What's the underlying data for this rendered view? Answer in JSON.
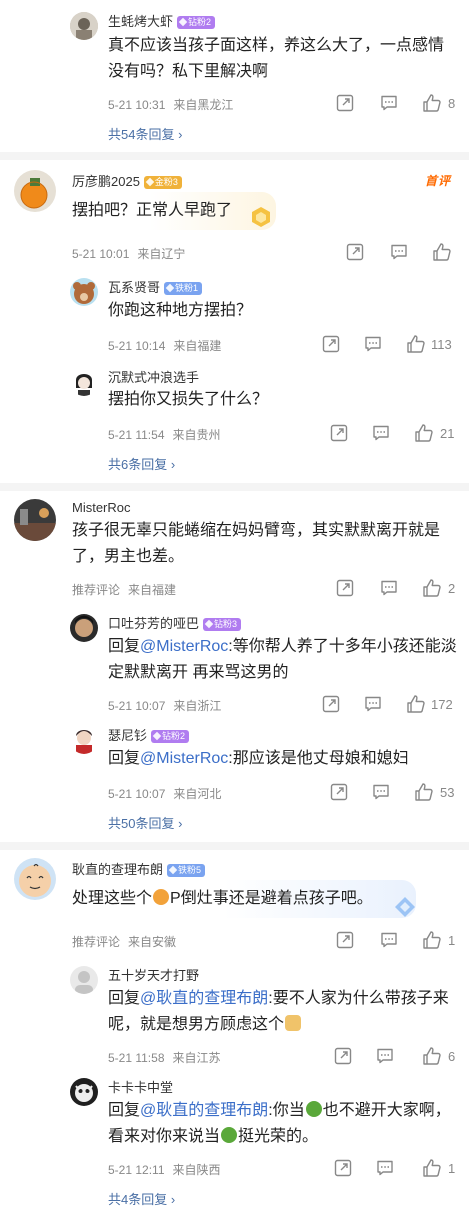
{
  "icons": {
    "share": "share-icon",
    "comment": "comment-icon",
    "like": "thumbs-up-icon",
    "more": "chevron-right-icon"
  },
  "colors": {
    "link": "#3b6ec8",
    "more_link": "#4a6fa5",
    "hot_badge": "#ff6a00",
    "badge_purple": "#b07cf0",
    "badge_blue": "#7aa3f0",
    "badge_gold": "#f0b23a"
  },
  "top_reply": {
    "user": "生蚝烤大虾",
    "badge": "钻粉2",
    "text": "真不应该当孩子面这样，养这么大了，一点感情没有吗？私下里解决啊",
    "time": "5-21 10:31",
    "location": "来自黑龙江",
    "likes": "8",
    "more": "共54条回复"
  },
  "comments": [
    {
      "user": "厉彦鹏2025",
      "badge": "金粉3",
      "hot_label": "首评",
      "text": "摆拍吧？正常人早跑了",
      "time": "5-21 10:01",
      "location": "来自辽宁",
      "likes": "",
      "replies": [
        {
          "user": "瓦系贤哥",
          "badge": "铁粉1",
          "text": "你跑这种地方摆拍？",
          "time": "5-21 10:14",
          "location": "来自福建",
          "likes": "113"
        },
        {
          "user": "沉默式冲浪选手",
          "badge": "",
          "text": "摆拍你又损失了什么？",
          "time": "5-21 11:54",
          "location": "来自贵州",
          "likes": "21"
        }
      ],
      "more": "共6条回复"
    },
    {
      "user": "MisterRoc",
      "badge": "",
      "text": "孩子很无辜只能蜷缩在妈妈臂弯，其实默默离开就是了，男主也差。",
      "time": "推荐评论",
      "location": "来自福建",
      "likes": "2",
      "replies": [
        {
          "user": "口吐芬芳的哑巴",
          "badge": "钻粉3",
          "reply_prefix": "回复",
          "mention": "@MisterRoc",
          "text": ":等你帮人养了十多年小孩还能淡定默默离开 再来骂这男的",
          "time": "5-21 10:07",
          "location": "来自浙江",
          "likes": "172"
        },
        {
          "user": "瑟尼钐",
          "badge": "钻粉2",
          "reply_prefix": "回复",
          "mention": "@MisterRoc",
          "text": ":那应该是他丈母娘和媳妇",
          "time": "5-21 10:07",
          "location": "来自河北",
          "likes": "53"
        }
      ],
      "more": "共50条回复"
    },
    {
      "user": "耿直的查理布朗",
      "badge": "铁粉5",
      "text_a": "处理这些个",
      "text_b": "P倒灶事还是避着点孩子吧。",
      "time": "推荐评论",
      "location": "来自安徽",
      "likes": "1",
      "replies": [
        {
          "user": "五十岁天才打野",
          "badge": "",
          "reply_prefix": "回复",
          "mention": "@耿直的查理布朗",
          "text": ":要不人家为什么带孩子来呢，就是想男方顾虑这个",
          "time": "5-21 11:58",
          "location": "来自江苏",
          "likes": "6"
        },
        {
          "user": "卡卡卡中堂",
          "badge": "",
          "reply_prefix": "回复",
          "mention": "@耿直的查理布朗",
          "text_a": ":你当",
          "text_b": "也不避开大家啊，看来对你来说当",
          "text_c": "挺光荣的。",
          "time": "5-21 12:11",
          "location": "来自陕西",
          "likes": "1"
        }
      ],
      "more": "共4条回复"
    }
  ]
}
